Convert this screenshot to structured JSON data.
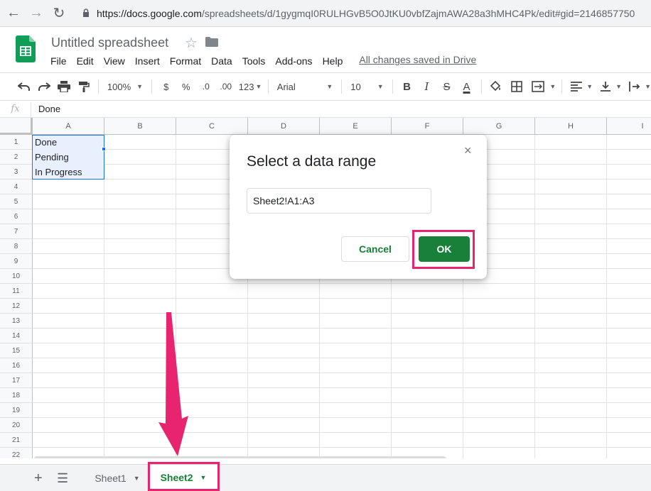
{
  "browser": {
    "url_host": "https://docs.google.com",
    "url_path": "/spreadsheets/d/1gygmqI0RULHGvB5O0JtKU0vbfZajmAWA28a3hMHC4Pk/edit#gid=2146857750"
  },
  "app": {
    "title": "Untitled spreadsheet",
    "menu": [
      "File",
      "Edit",
      "View",
      "Insert",
      "Format",
      "Data",
      "Tools",
      "Add-ons",
      "Help"
    ],
    "save_status": "All changes saved in Drive"
  },
  "toolbar": {
    "zoom": "100%",
    "currency": "$",
    "percent": "%",
    "decrease_decimal": ".0",
    "increase_decimal": ".00",
    "more_formats": "123",
    "font": "Arial",
    "font_size": "10",
    "bold": "B",
    "italic": "I",
    "strikethrough": "S",
    "text_color": "A"
  },
  "formula_bar": {
    "fx": "fx",
    "value": "Done"
  },
  "grid": {
    "columns": [
      "A",
      "B",
      "C",
      "D",
      "E",
      "F",
      "G",
      "H",
      "I"
    ],
    "rows": [
      "1",
      "2",
      "3",
      "4",
      "5",
      "6",
      "7",
      "8",
      "9",
      "10",
      "11",
      "12",
      "13",
      "14",
      "15",
      "16",
      "17",
      "18",
      "19",
      "20",
      "21",
      "22"
    ],
    "cells": {
      "A1": "Done",
      "A2": "Pending",
      "A3": "In Progress"
    }
  },
  "dialog": {
    "title": "Select a data range",
    "close": "×",
    "range_value": "Sheet2!A1:A3",
    "cancel_label": "Cancel",
    "ok_label": "OK"
  },
  "sheets": {
    "add": "+",
    "tabs": [
      "Sheet1",
      "Sheet2"
    ],
    "active": "Sheet2"
  },
  "colors": {
    "accent_green": "#188038",
    "highlight_pink": "#e8246e",
    "selection_blue": "#1a73e8"
  }
}
